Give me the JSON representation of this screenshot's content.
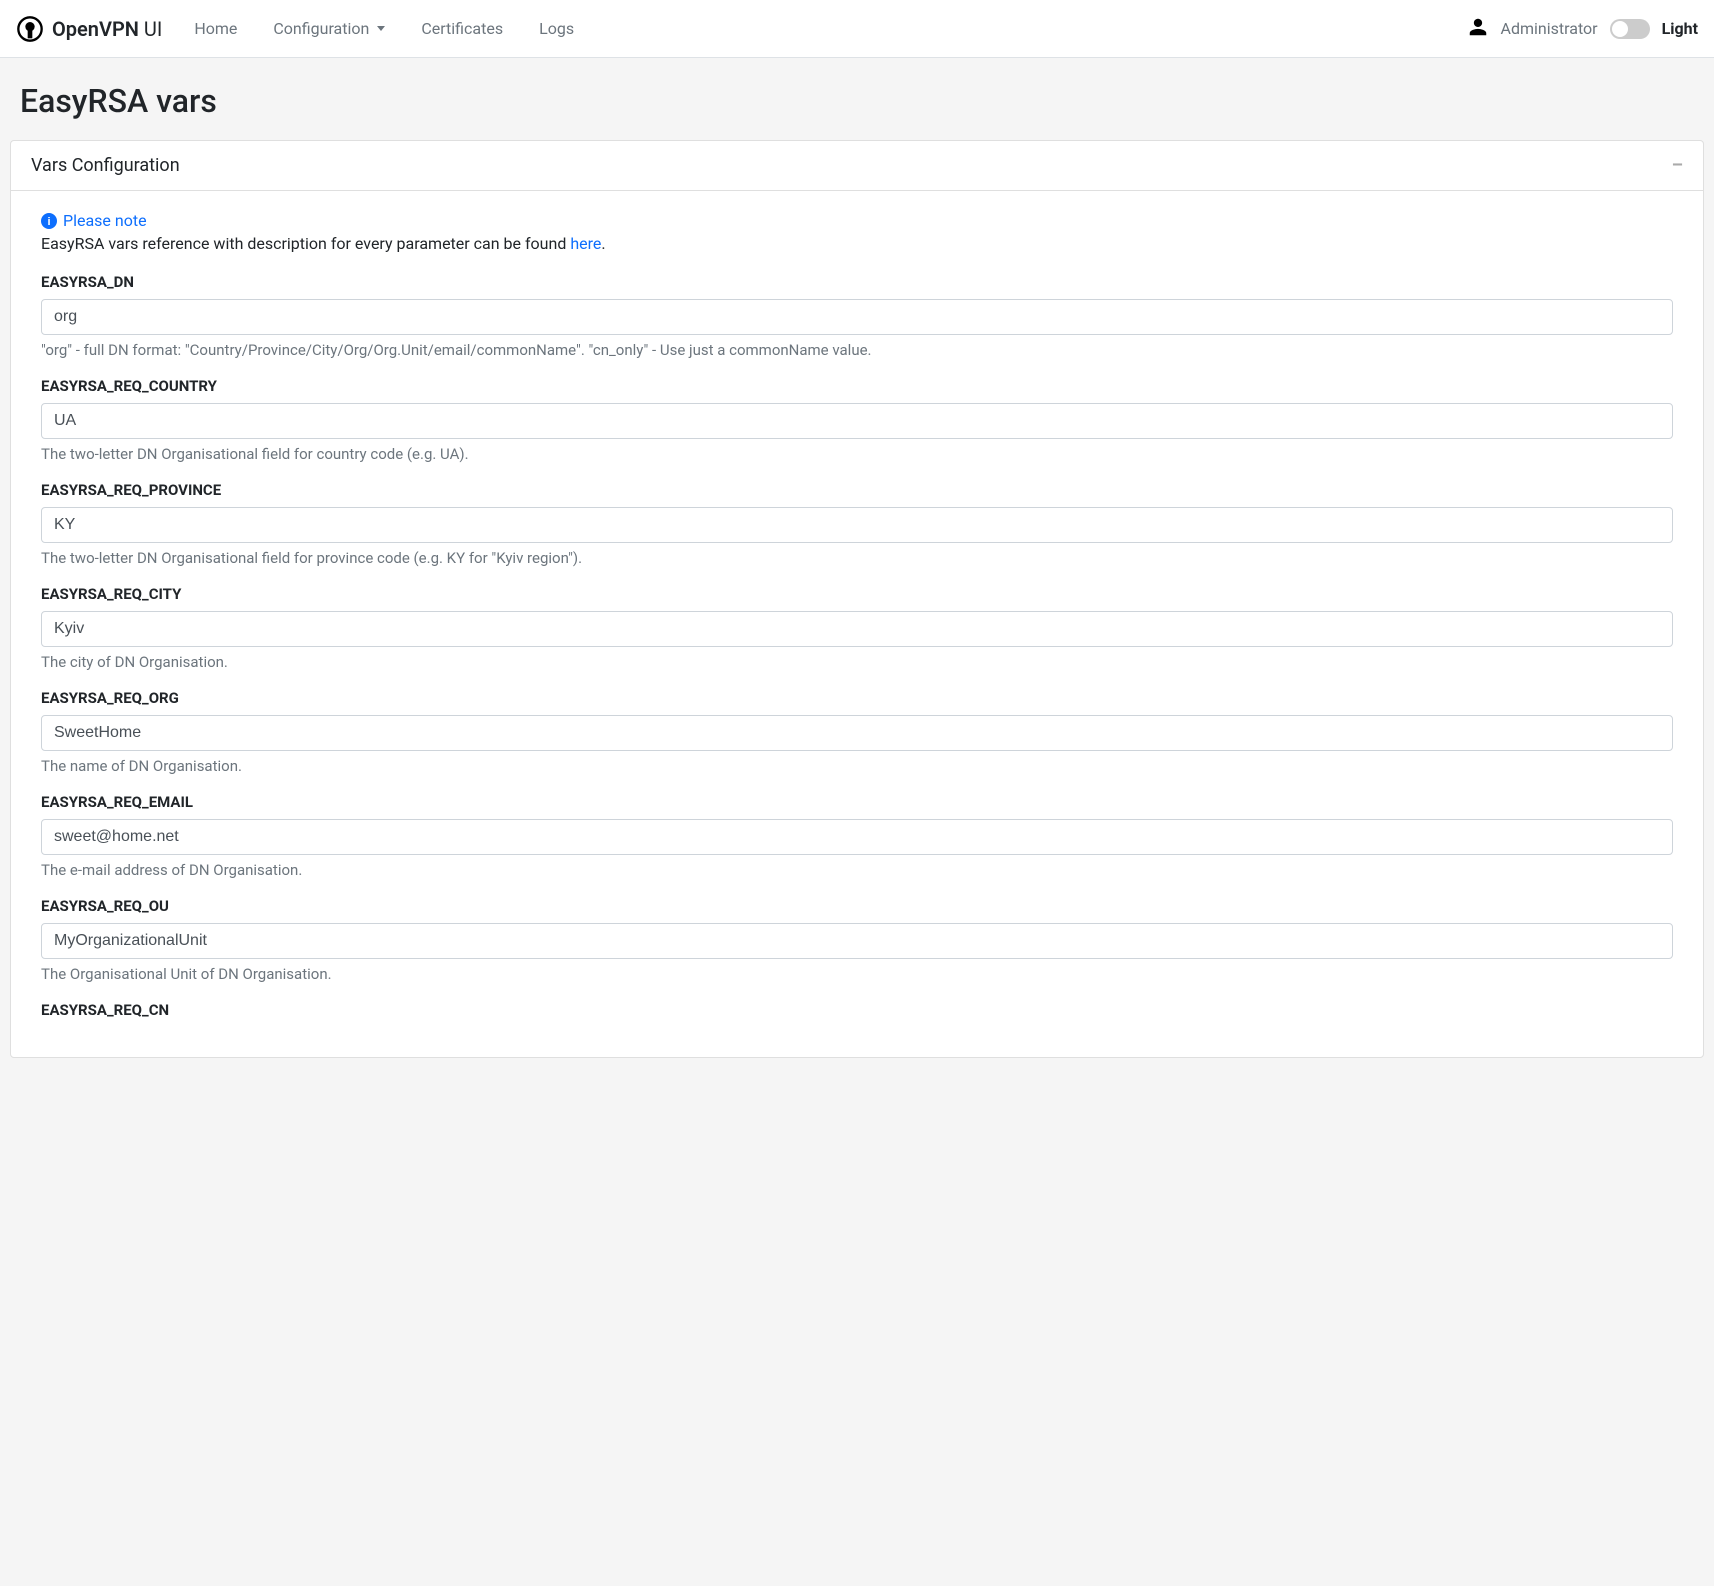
{
  "brand": {
    "bold": "OpenVPN",
    "light": " UI"
  },
  "nav": {
    "home": "Home",
    "configuration": "Configuration",
    "certificates": "Certificates",
    "logs": "Logs"
  },
  "user": {
    "name": "Administrator",
    "theme": "Light"
  },
  "page": {
    "title": "EasyRSA vars"
  },
  "card": {
    "title": "Vars Configuration"
  },
  "note": {
    "title": "Please note",
    "desc_prefix": "EasyRSA vars reference with description for every parameter can be found ",
    "link_text": "here",
    "desc_suffix": "."
  },
  "fields": {
    "dn": {
      "label": "EASYRSA_DN",
      "value": "org",
      "help": "\"org\" - full DN format: \"Country/Province/City/Org/Org.Unit/email/commonName\". \"cn_only\" - Use just a commonName value."
    },
    "country": {
      "label": "EASYRSA_REQ_COUNTRY",
      "value": "UA",
      "help": "The two-letter DN Organisational field for country code (e.g. UA)."
    },
    "province": {
      "label": "EASYRSA_REQ_PROVINCE",
      "value": "KY",
      "help": "The two-letter DN Organisational field for province code (e.g. KY for \"Kyiv region\")."
    },
    "city": {
      "label": "EASYRSA_REQ_CITY",
      "value": "Kyiv",
      "help": "The city of DN Organisation."
    },
    "org": {
      "label": "EASYRSA_REQ_ORG",
      "value": "SweetHome",
      "help": "The name of DN Organisation."
    },
    "email": {
      "label": "EASYRSA_REQ_EMAIL",
      "value": "sweet@home.net",
      "help": "The e-mail address of DN Organisation."
    },
    "ou": {
      "label": "EASYRSA_REQ_OU",
      "value": "MyOrganizationalUnit",
      "help": "The Organisational Unit of DN Organisation."
    },
    "cn": {
      "label": "EASYRSA_REQ_CN"
    }
  }
}
